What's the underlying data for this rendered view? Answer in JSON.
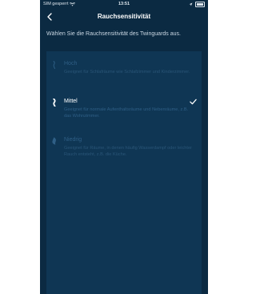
{
  "status_bar": {
    "carrier": "SIM gesperrt",
    "time": "13:51"
  },
  "nav": {
    "title": "Rauchsensitivität",
    "back_icon": "chevron-left-icon"
  },
  "subtitle": "Wählen Sie die Rauchsensitivität des Twinguards aus.",
  "options": [
    {
      "label": "Hoch",
      "description": "Geeignet für Schlafräume wie Schlafzimmer und Kinderzimmer.",
      "selected": false,
      "icon": "flame-thin-icon"
    },
    {
      "label": "Mittel",
      "description": "Geeignet für normale Aufenthaltsräume und Nebenräume, z.B. das Wohnzimmer.",
      "selected": true,
      "icon": "flame-medium-icon"
    },
    {
      "label": "Niedrig",
      "description": "Geeignet für Räume, in denen häufig Wasserdampf oder leichter Rauch entsteht, z.B. die Küche.",
      "selected": false,
      "icon": "flame-thick-icon"
    }
  ],
  "colors": {
    "background": "#0b2a42",
    "card": "#0f3654",
    "dim_text": "#2f5f86",
    "active_text": "#ffffff"
  }
}
